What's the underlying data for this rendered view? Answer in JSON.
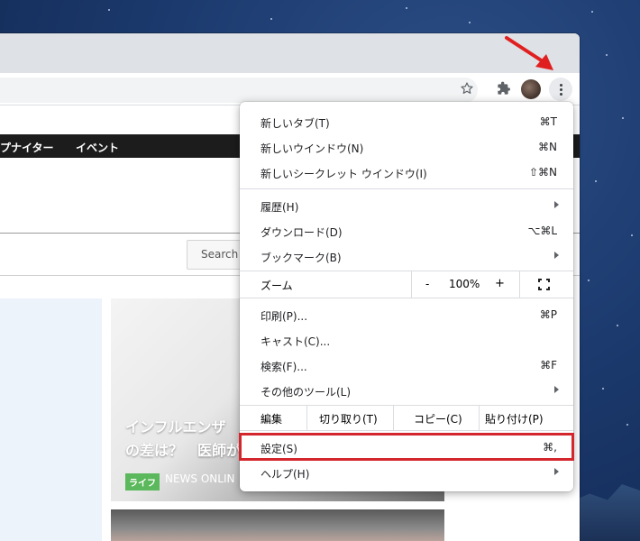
{
  "browser": {
    "toolbar_icons": [
      "star-icon",
      "extensions-icon",
      "profile-avatar",
      "more-menu-icon"
    ]
  },
  "page": {
    "nav": [
      "プナイター",
      "イベント"
    ],
    "search_placeholder": "Search",
    "article": {
      "title_line1": "インフルエンザ",
      "title_line2": "の差は？　医師が",
      "tag": "ライフ",
      "source": "NEWS ONLIN"
    }
  },
  "menu": {
    "new_tab": {
      "label": "新しいタブ(T)",
      "shortcut": "⌘T"
    },
    "new_window": {
      "label": "新しいウインドウ(N)",
      "shortcut": "⌘N"
    },
    "new_incognito": {
      "label": "新しいシークレット ウインドウ(I)",
      "shortcut": "⇧⌘N"
    },
    "history": {
      "label": "履歴(H)"
    },
    "downloads": {
      "label": "ダウンロード(D)",
      "shortcut": "⌥⌘L"
    },
    "bookmarks": {
      "label": "ブックマーク(B)"
    },
    "zoom": {
      "label": "ズーム",
      "minus": "-",
      "value": "100%",
      "plus": "+"
    },
    "print": {
      "label": "印刷(P)...",
      "shortcut": "⌘P"
    },
    "cast": {
      "label": "キャスト(C)..."
    },
    "find": {
      "label": "検索(F)...",
      "shortcut": "⌘F"
    },
    "more_tools": {
      "label": "その他のツール(L)"
    },
    "edit": {
      "label": "編集",
      "cut": "切り取り(T)",
      "copy": "コピー(C)",
      "paste": "貼り付け(P)"
    },
    "settings": {
      "label": "設定(S)",
      "shortcut": "⌘,"
    },
    "help": {
      "label": "ヘルプ(H)"
    }
  },
  "colors": {
    "highlight": "#d3262d",
    "arrow": "#e02020"
  }
}
